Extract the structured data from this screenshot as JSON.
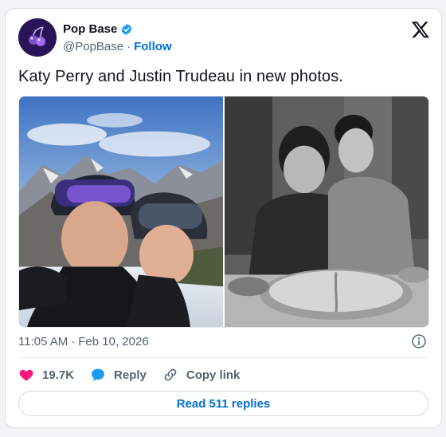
{
  "author": {
    "display_name": "Pop Base",
    "handle": "@PopBase",
    "separator": "·",
    "follow_label": "Follow"
  },
  "tweet": {
    "text": "Katy Perry and Justin Trudeau in new photos.",
    "time": "11:05 AM",
    "date_separator": "·",
    "date": "Feb 10, 2026"
  },
  "engagement": {
    "likes": "19.7K",
    "reply_label": "Reply",
    "copy_link_label": "Copy link",
    "read_replies_label": "Read 511 replies"
  },
  "icons": {
    "platform_logo": "x-logo-icon",
    "verified": "verified-badge-icon",
    "like": "heart-icon",
    "reply": "speech-bubble-icon",
    "copy_link": "link-icon",
    "info": "info-icon"
  },
  "colors": {
    "link_blue": "#006fd6",
    "verified_blue": "#1d9bf0",
    "heart_pink": "#f91880",
    "muted_text": "#536471"
  }
}
